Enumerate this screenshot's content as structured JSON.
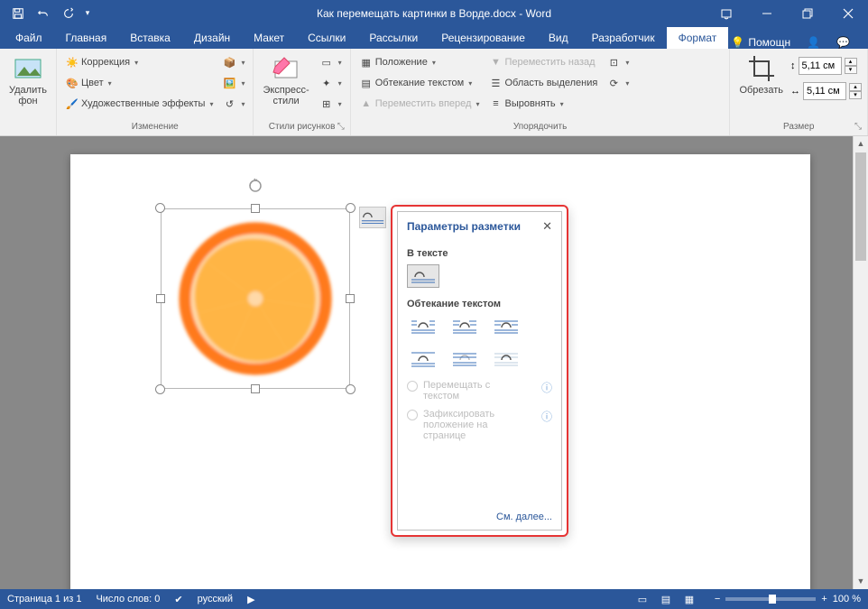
{
  "titlebar": {
    "doc_title": "Как перемещать картинки в Ворде.docx - Word"
  },
  "tabs": {
    "file": "Файл",
    "home": "Главная",
    "insert": "Вставка",
    "design": "Дизайн",
    "layout": "Макет",
    "references": "Ссылки",
    "mailings": "Рассылки",
    "review": "Рецензирование",
    "view": "Вид",
    "developer": "Разработчик",
    "format": "Формат",
    "help": "Помощн"
  },
  "ribbon": {
    "remove_bg": "Удалить\nфон",
    "corrections": "Коррекция",
    "color": "Цвет",
    "artistic": "Художественные эффекты",
    "adjust_group": "Изменение",
    "express": "Экспресс-\nстили",
    "styles_group": "Стили рисунков",
    "position": "Положение",
    "wrap": "Обтекание текстом",
    "forward": "Переместить вперед",
    "backward": "Переместить назад",
    "selection": "Область выделения",
    "align": "Выровнять",
    "arrange_group": "Упорядочить",
    "crop": "Обрезать",
    "height": "5,11 см",
    "width": "5,11 см",
    "size_group": "Размер"
  },
  "layout_popup": {
    "title": "Параметры разметки",
    "inline": "В тексте",
    "wrapping": "Обтекание текстом",
    "radio_move": "Перемещать с текстом",
    "radio_fix": "Зафиксировать положение на странице",
    "see_more": "См. далее..."
  },
  "statusbar": {
    "page": "Страница 1 из 1",
    "words": "Число слов: 0",
    "lang": "русский",
    "zoom": "100 %"
  }
}
